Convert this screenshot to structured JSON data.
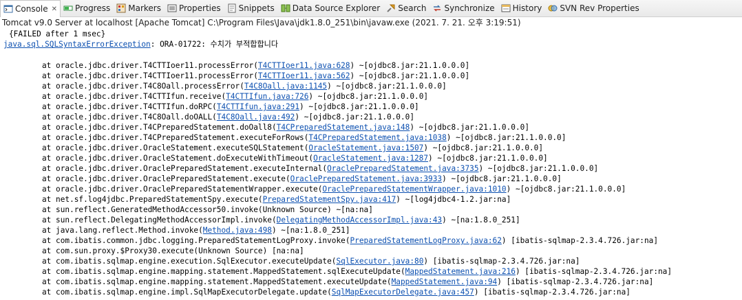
{
  "tabs": [
    {
      "name": "console",
      "label": "Console",
      "icon": "console-icon",
      "active": true
    },
    {
      "name": "progress",
      "label": "Progress",
      "icon": "progress-icon"
    },
    {
      "name": "markers",
      "label": "Markers",
      "icon": "markers-icon"
    },
    {
      "name": "properties",
      "label": "Properties",
      "icon": "properties-icon"
    },
    {
      "name": "snippets",
      "label": "Snippets",
      "icon": "snippets-icon"
    },
    {
      "name": "data-source-explorer",
      "label": "Data Source Explorer",
      "icon": "database-icon"
    },
    {
      "name": "search",
      "label": "Search",
      "icon": "search-icon"
    },
    {
      "name": "synchronize",
      "label": "Synchronize",
      "icon": "synchronize-icon"
    },
    {
      "name": "history",
      "label": "History",
      "icon": "history-icon"
    },
    {
      "name": "svn-rev-properties",
      "label": "SVN Rev Properties",
      "icon": "svn-icon"
    }
  ],
  "close_glyph": "✕",
  "status": "Tomcat v9.0 Server at localhost [Apache Tomcat] C:\\Program Files\\Java\\jdk1.8.0_251\\bin\\javaw.exe (2021. 7. 21. 오후 3:19:51)",
  "console": {
    "failed": "{FAILED after 1 msec}",
    "exception_link": "java.sql.SQLSyntaxErrorException",
    "exception_message": ": ORA-01722: 수치가 부적합합니다",
    "trace": [
      {
        "prefix": "at oracle.jdbc.driver.T4CTTIoer11.processError(",
        "link": "T4CTTIoer11.java:628",
        "suffix": ") ~[ojdbc8.jar:21.1.0.0.0]"
      },
      {
        "prefix": "at oracle.jdbc.driver.T4CTTIoer11.processError(",
        "link": "T4CTTIoer11.java:562",
        "suffix": ") ~[ojdbc8.jar:21.1.0.0.0]"
      },
      {
        "prefix": "at oracle.jdbc.driver.T4C8Oall.processError(",
        "link": "T4C8Oall.java:1145",
        "suffix": ") ~[ojdbc8.jar:21.1.0.0.0]"
      },
      {
        "prefix": "at oracle.jdbc.driver.T4CTTIfun.receive(",
        "link": "T4CTTIfun.java:726",
        "suffix": ") ~[ojdbc8.jar:21.1.0.0.0]"
      },
      {
        "prefix": "at oracle.jdbc.driver.T4CTTIfun.doRPC(",
        "link": "T4CTTIfun.java:291",
        "suffix": ") ~[ojdbc8.jar:21.1.0.0.0]"
      },
      {
        "prefix": "at oracle.jdbc.driver.T4C8Oall.doOALL(",
        "link": "T4C8Oall.java:492",
        "suffix": ") ~[ojdbc8.jar:21.1.0.0.0]"
      },
      {
        "prefix": "at oracle.jdbc.driver.T4CPreparedStatement.doOall8(",
        "link": "T4CPreparedStatement.java:148",
        "suffix": ") ~[ojdbc8.jar:21.1.0.0.0]"
      },
      {
        "prefix": "at oracle.jdbc.driver.T4CPreparedStatement.executeForRows(",
        "link": "T4CPreparedStatement.java:1038",
        "suffix": ") ~[ojdbc8.jar:21.1.0.0.0]"
      },
      {
        "prefix": "at oracle.jdbc.driver.OracleStatement.executeSQLStatement(",
        "link": "OracleStatement.java:1507",
        "suffix": ") ~[ojdbc8.jar:21.1.0.0.0]"
      },
      {
        "prefix": "at oracle.jdbc.driver.OracleStatement.doExecuteWithTimeout(",
        "link": "OracleStatement.java:1287",
        "suffix": ") ~[ojdbc8.jar:21.1.0.0.0]"
      },
      {
        "prefix": "at oracle.jdbc.driver.OraclePreparedStatement.executeInternal(",
        "link": "OraclePreparedStatement.java:3735",
        "suffix": ") ~[ojdbc8.jar:21.1.0.0.0]"
      },
      {
        "prefix": "at oracle.jdbc.driver.OraclePreparedStatement.execute(",
        "link": "OraclePreparedStatement.java:3933",
        "suffix": ") ~[ojdbc8.jar:21.1.0.0.0]"
      },
      {
        "prefix": "at oracle.jdbc.driver.OraclePreparedStatementWrapper.execute(",
        "link": "OraclePreparedStatementWrapper.java:1010",
        "suffix": ") ~[ojdbc8.jar:21.1.0.0.0]"
      },
      {
        "prefix": "at net.sf.log4jdbc.PreparedStatementSpy.execute(",
        "link": "PreparedStatementSpy.java:417",
        "suffix": ") ~[log4jdbc4-1.2.jar:na]"
      },
      {
        "prefix": "at sun.reflect.GeneratedMethodAccessor50.invoke(Unknown Source) ~[na:na]",
        "link": "",
        "suffix": ""
      },
      {
        "prefix": "at sun.reflect.DelegatingMethodAccessorImpl.invoke(",
        "link": "DelegatingMethodAccessorImpl.java:43",
        "suffix": ") ~[na:1.8.0_251]"
      },
      {
        "prefix": "at java.lang.reflect.Method.invoke(",
        "link": "Method.java:498",
        "suffix": ") ~[na:1.8.0_251]"
      },
      {
        "prefix": "at com.ibatis.common.jdbc.logging.PreparedStatementLogProxy.invoke(",
        "link": "PreparedStatementLogProxy.java:62",
        "suffix": ") [ibatis-sqlmap-2.3.4.726.jar:na]"
      },
      {
        "prefix": "at com.sun.proxy.$Proxy30.execute(Unknown Source) [na:na]",
        "link": "",
        "suffix": ""
      },
      {
        "prefix": "at com.ibatis.sqlmap.engine.execution.SqlExecutor.executeUpdate(",
        "link": "SqlExecutor.java:80",
        "suffix": ") [ibatis-sqlmap-2.3.4.726.jar:na]"
      },
      {
        "prefix": "at com.ibatis.sqlmap.engine.mapping.statement.MappedStatement.sqlExecuteUpdate(",
        "link": "MappedStatement.java:216",
        "suffix": ") [ibatis-sqlmap-2.3.4.726.jar:na]"
      },
      {
        "prefix": "at com.ibatis.sqlmap.engine.mapping.statement.MappedStatement.executeUpdate(",
        "link": "MappedStatement.java:94",
        "suffix": ") [ibatis-sqlmap-2.3.4.726.jar:na]"
      },
      {
        "prefix": "at com.ibatis.sqlmap.engine.impl.SqlMapExecutorDelegate.update(",
        "link": "SqlMapExecutorDelegate.java:457",
        "suffix": ") [ibatis-sqlmap-2.3.4.726.jar:na]"
      }
    ]
  }
}
